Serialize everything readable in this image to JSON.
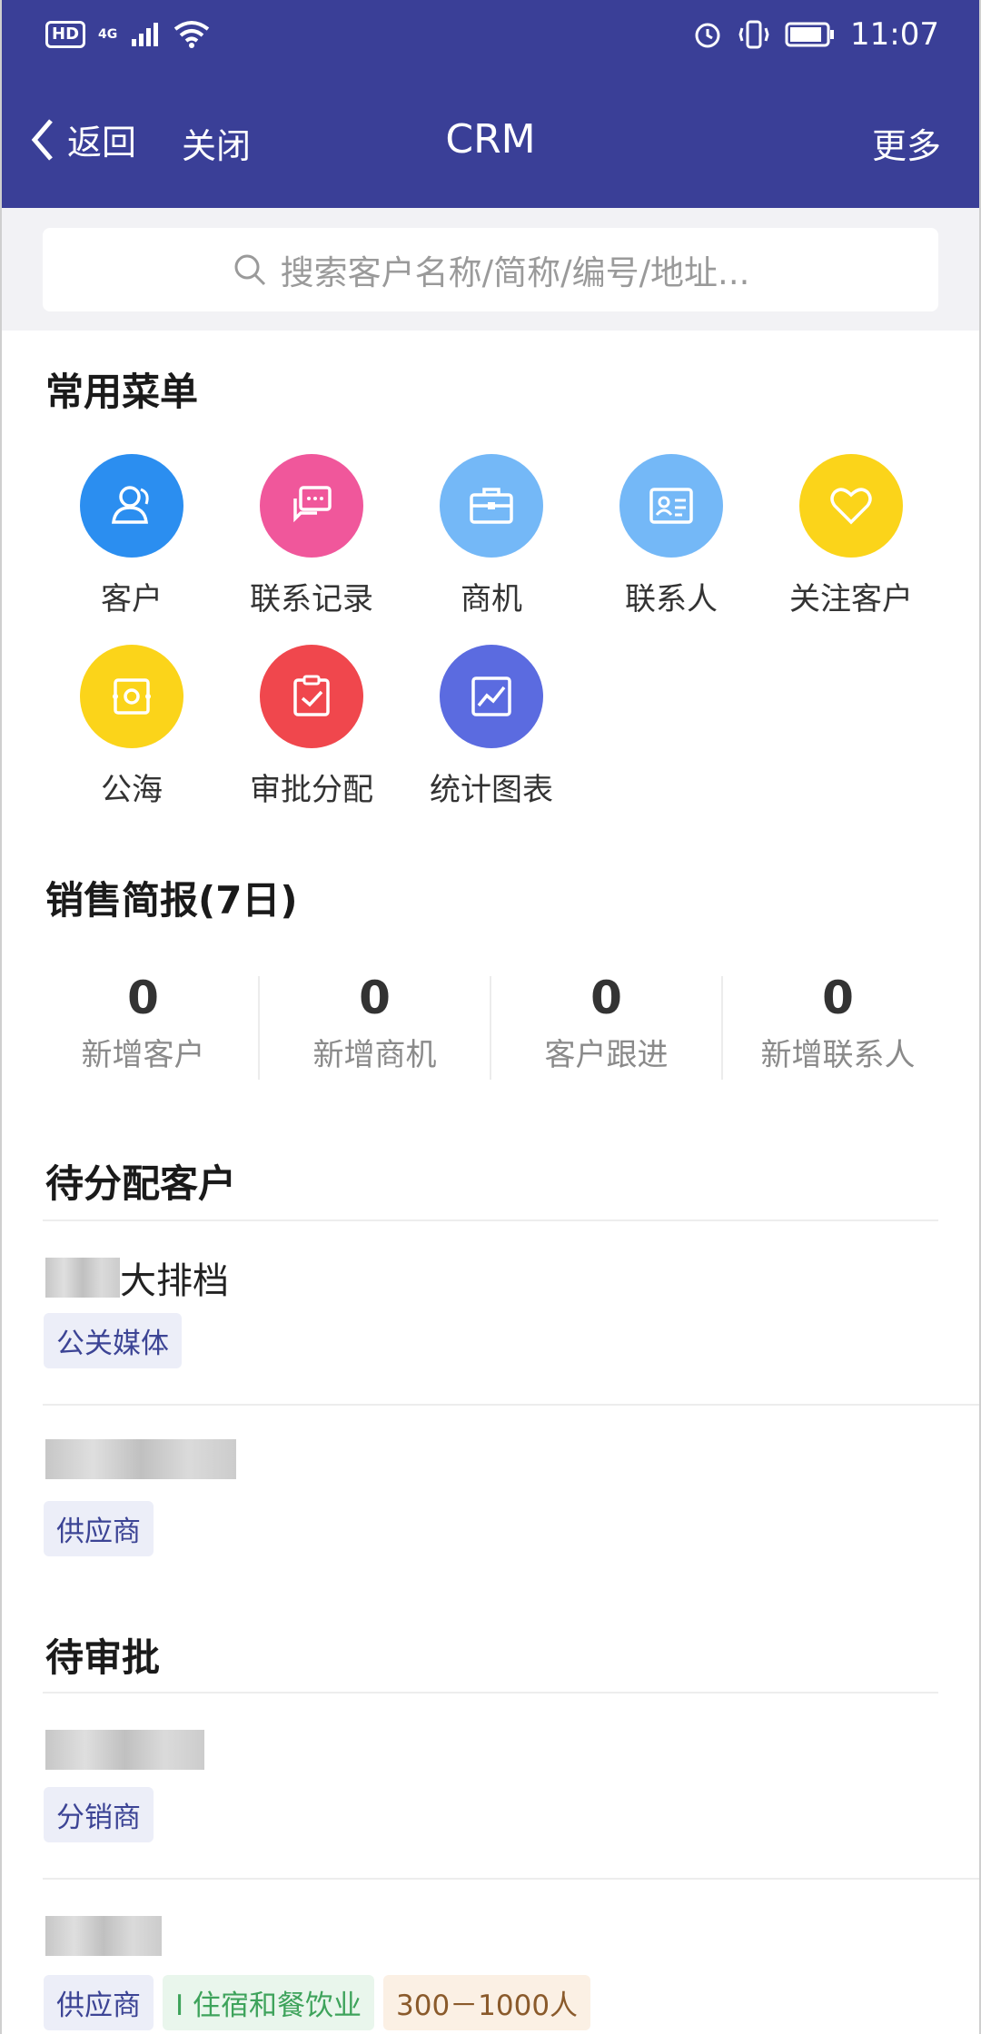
{
  "status_bar": {
    "left_badge": "HD",
    "network": "4G",
    "time": "11:07"
  },
  "nav": {
    "back": "返回",
    "close": "关闭",
    "title": "CRM",
    "more": "更多"
  },
  "search": {
    "placeholder": "搜索客户名称/简称/编号/地址..."
  },
  "common_menu": {
    "title": "常用菜单",
    "items": [
      {
        "label": "客户",
        "icon": "customer-icon",
        "color": "#2b8ef0"
      },
      {
        "label": "联系记录",
        "icon": "chat-icon",
        "color": "#f0579b"
      },
      {
        "label": "商机",
        "icon": "briefcase-icon",
        "color": "#74b8f7"
      },
      {
        "label": "联系人",
        "icon": "contact-card-icon",
        "color": "#74b8f7"
      },
      {
        "label": "关注客户",
        "icon": "heart-icon",
        "color": "#fbd41a"
      },
      {
        "label": "公海",
        "icon": "pool-icon",
        "color": "#fbd41a"
      },
      {
        "label": "审批分配",
        "icon": "clipboard-check-icon",
        "color": "#f0474d"
      },
      {
        "label": "统计图表",
        "icon": "chart-icon",
        "color": "#5b6be0"
      }
    ]
  },
  "sales_report": {
    "title": "销售简报(7日)",
    "stats": [
      {
        "value": "0",
        "label": "新增客户"
      },
      {
        "value": "0",
        "label": "新增商机"
      },
      {
        "value": "0",
        "label": "客户跟进"
      },
      {
        "value": "0",
        "label": "新增联系人"
      }
    ]
  },
  "pending_assign": {
    "title": "待分配客户",
    "items": [
      {
        "name_suffix": "大排档",
        "tags": [
          "公关媒体"
        ]
      },
      {
        "name_suffix": "",
        "tags": [
          "供应商"
        ]
      }
    ]
  },
  "pending_approval": {
    "title": "待审批",
    "items": [
      {
        "tags": [
          "分销商"
        ]
      },
      {
        "tags": [
          "供应商",
          "I 住宿和餐饮业",
          "300－1000人"
        ]
      }
    ]
  }
}
